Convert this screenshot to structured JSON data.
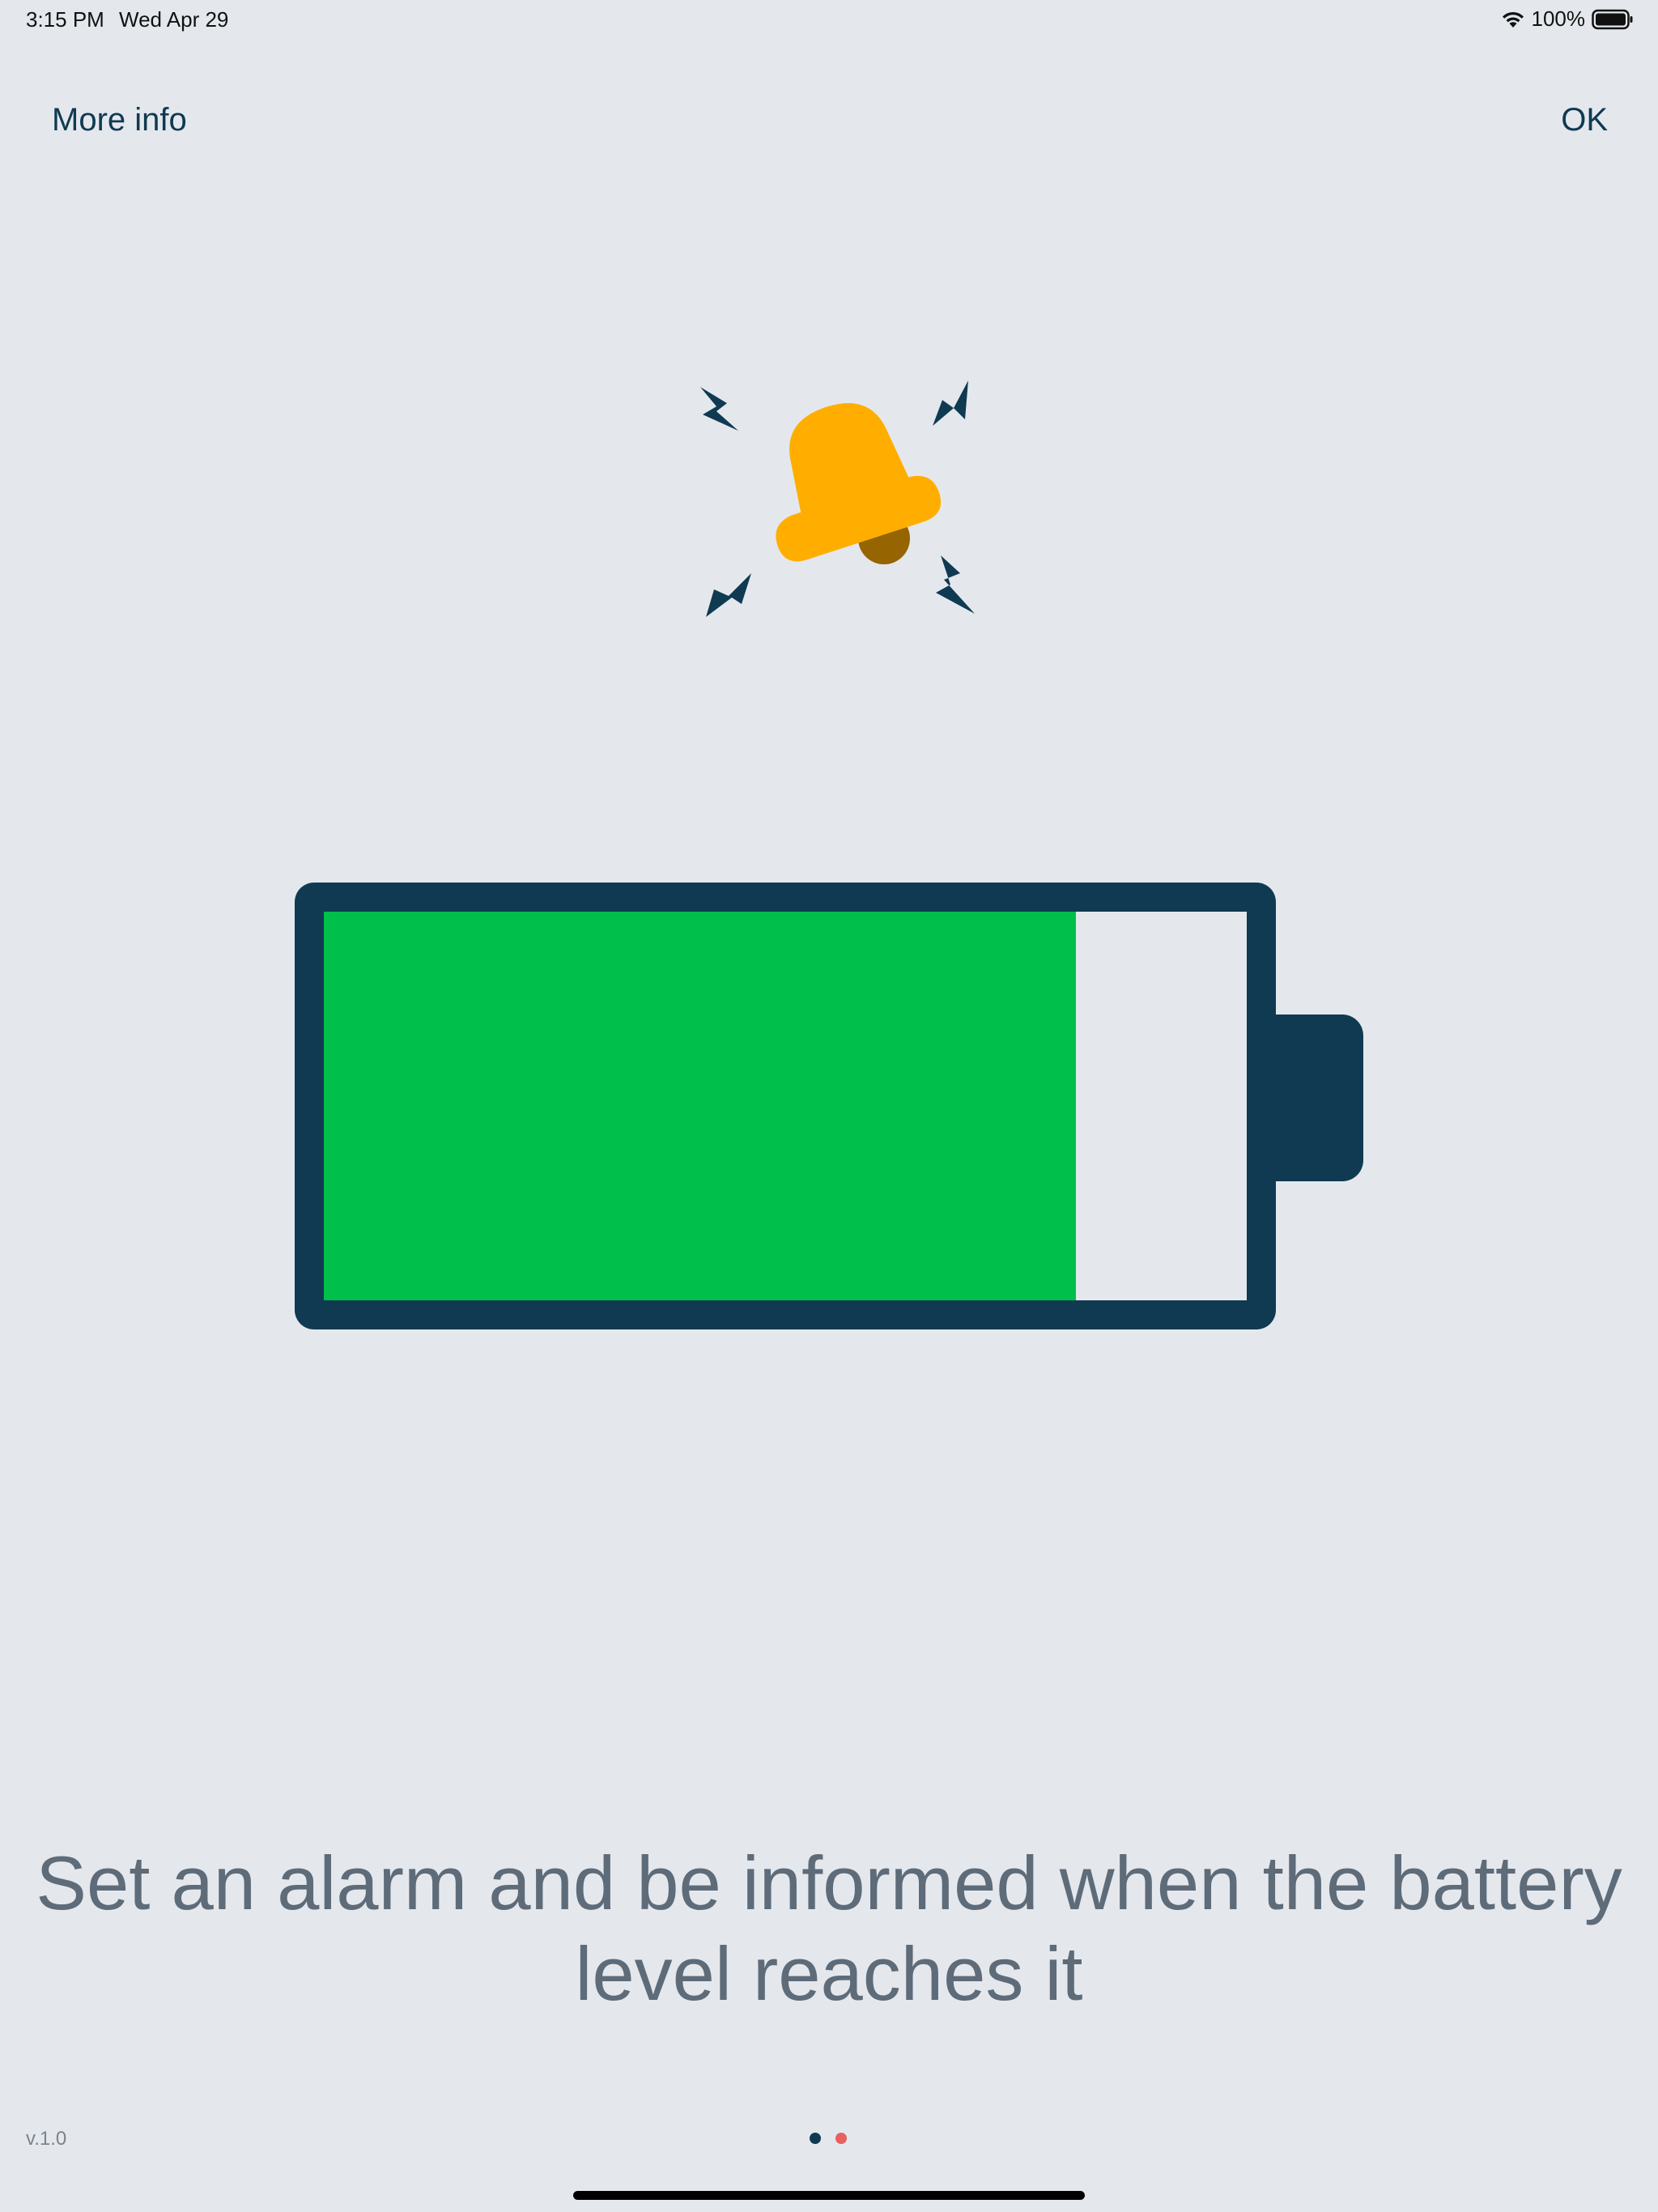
{
  "status_bar": {
    "time": "3:15 PM",
    "date": "Wed Apr 29",
    "battery_percent": "100%",
    "icons": [
      "wifi-icon",
      "battery-icon"
    ]
  },
  "nav": {
    "more_info_label": "More info",
    "ok_label": "OK"
  },
  "illustration": {
    "icons": [
      "alarm-bell-icon",
      "lightning-bolt-icon"
    ],
    "colors": {
      "bell": "#ffae00",
      "clapper": "#966400",
      "bolts": "#0f3a52"
    }
  },
  "battery": {
    "fill_fraction": 0.815,
    "colors": {
      "outline": "#0f3a52",
      "fill": "#00bf4b",
      "empty": "#e4e8ed"
    }
  },
  "caption": "Set an alarm and be informed when the battery level reaches it",
  "footer": {
    "version": "v.1.0",
    "page_indicator": {
      "count": 2,
      "current": 1,
      "colors": [
        "#0f3a52",
        "#e8605f"
      ]
    }
  }
}
